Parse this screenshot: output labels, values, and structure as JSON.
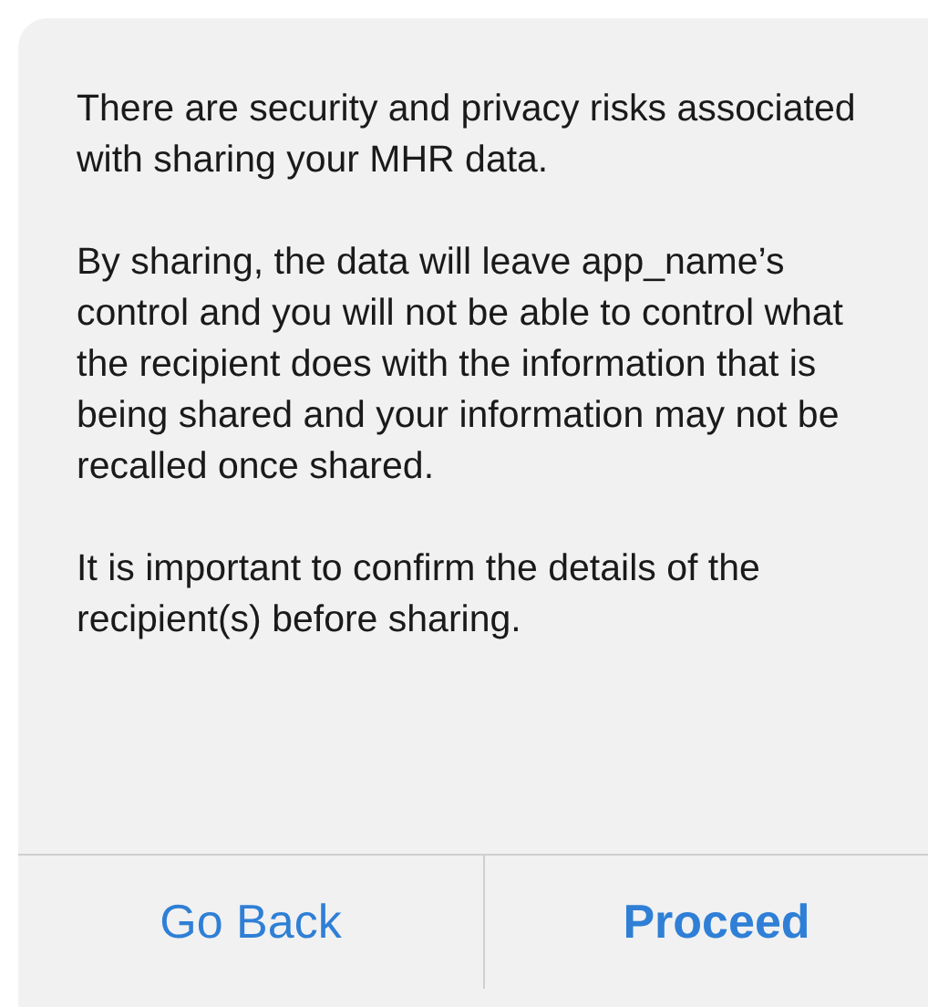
{
  "alert": {
    "paragraphs": [
      "There are security and privacy risks associated with sharing your MHR data.",
      "By sharing, the data will leave app_name’s control and you will not be able to control what the recipient does with the information that is being shared and your information may not be recalled once shared.",
      "It is important to confirm the details of the recipient(s) before sharing."
    ],
    "buttons": [
      {
        "label": "Go Back",
        "emphasized": false
      },
      {
        "label": "Proceed",
        "emphasized": true
      }
    ]
  }
}
